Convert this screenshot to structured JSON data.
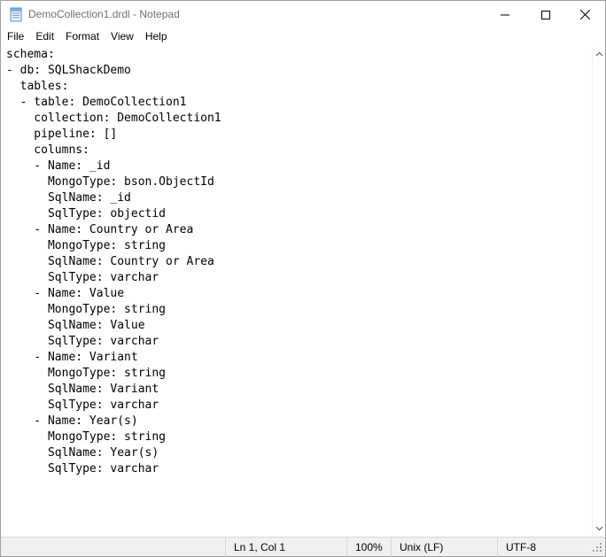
{
  "window": {
    "title": "DemoCollection1.drdl - Notepad"
  },
  "menu": {
    "items": [
      "File",
      "Edit",
      "Format",
      "View",
      "Help"
    ]
  },
  "editor": {
    "lines": [
      "schema:",
      "- db: SQLShackDemo",
      "  tables:",
      "  - table: DemoCollection1",
      "    collection: DemoCollection1",
      "    pipeline: []",
      "    columns:",
      "    - Name: _id",
      "      MongoType: bson.ObjectId",
      "      SqlName: _id",
      "      SqlType: objectid",
      "    - Name: Country or Area",
      "      MongoType: string",
      "      SqlName: Country or Area",
      "      SqlType: varchar",
      "    - Name: Value",
      "      MongoType: string",
      "      SqlName: Value",
      "      SqlType: varchar",
      "    - Name: Variant",
      "      MongoType: string",
      "      SqlName: Variant",
      "      SqlType: varchar",
      "    - Name: Year(s)",
      "      MongoType: string",
      "      SqlName: Year(s)",
      "      SqlType: varchar"
    ]
  },
  "status": {
    "position": "Ln 1, Col 1",
    "zoom": "100%",
    "line_ending": "Unix (LF)",
    "encoding": "UTF-8"
  },
  "icons": {
    "app": "notepad-icon",
    "minimize": "minimize-icon",
    "maximize": "maximize-icon",
    "close": "close-icon",
    "scroll_up": "chevron-up-icon",
    "scroll_down": "chevron-down-icon",
    "grip": "resize-grip-icon"
  },
  "colors": {
    "title_text": "#707070",
    "status_bg": "#f0f0f0"
  }
}
